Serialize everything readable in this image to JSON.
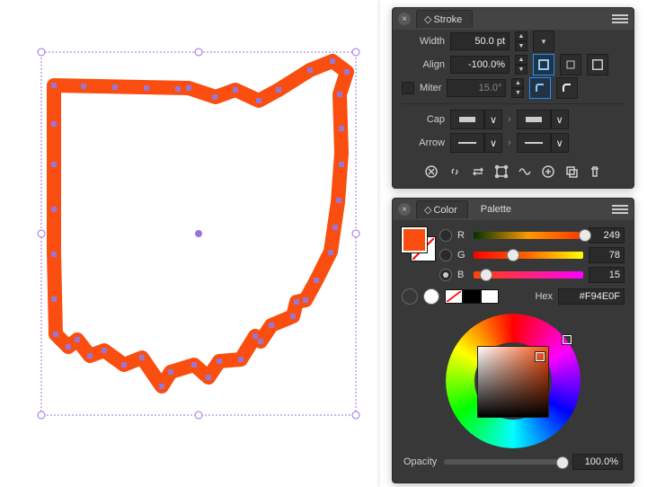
{
  "stroke_panel": {
    "tab": "Stroke",
    "width_label": "Width",
    "width_value": "50.0 pt",
    "align_label": "Align",
    "align_value": "-100.0%",
    "miter_label": "Miter",
    "miter_value": "15.0°",
    "cap_label": "Cap",
    "arrow_label": "Arrow",
    "tool_icons": [
      "close-circle",
      "link",
      "swap",
      "bounds",
      "wave",
      "add",
      "copy",
      "trash"
    ]
  },
  "color_panel": {
    "tabs": [
      "Color",
      "Palette"
    ],
    "channels": {
      "r": {
        "label": "R",
        "value": "249",
        "pos": 96
      },
      "g": {
        "label": "G",
        "value": "78",
        "pos": 30
      },
      "b": {
        "label": "B",
        "value": "15",
        "pos": 6
      }
    },
    "hex_label": "Hex",
    "hex_value": "#F94E0F",
    "opacity_label": "Opacity",
    "opacity_value": "100.0%",
    "swatch_color": "#F94E0F"
  }
}
